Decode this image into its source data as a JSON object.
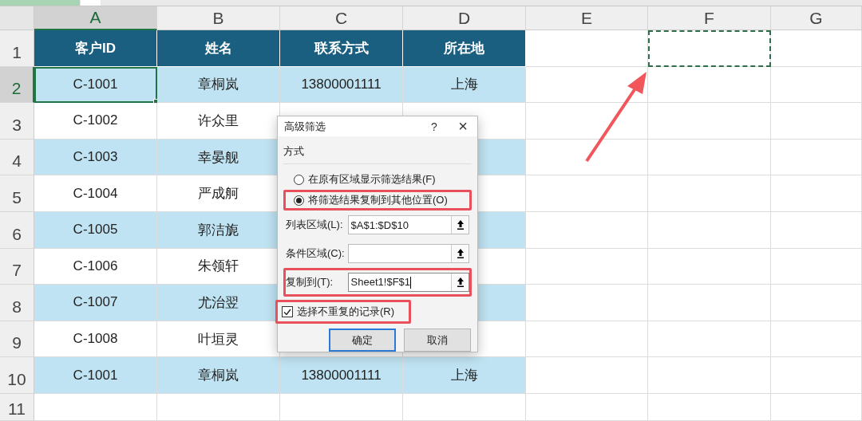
{
  "column_headers": [
    {
      "label": "A",
      "selected": true,
      "copy_outline": false
    },
    {
      "label": "B",
      "selected": false,
      "copy_outline": false
    },
    {
      "label": "C",
      "selected": false,
      "copy_outline": false
    },
    {
      "label": "D",
      "selected": false,
      "copy_outline": false
    },
    {
      "label": "E",
      "selected": false,
      "copy_outline": false
    },
    {
      "label": "F",
      "selected": false,
      "copy_outline": true
    },
    {
      "label": "G",
      "selected": false,
      "copy_outline": false
    }
  ],
  "rows": [
    {
      "label": "1",
      "selected": false,
      "kind": "header",
      "shaded": true,
      "copy_outline": true,
      "cells": [
        {
          "text": "客户ID",
          "selected": false
        },
        {
          "text": "姓名",
          "selected": false
        },
        {
          "text": "联系方式",
          "selected": false
        },
        {
          "text": "所在地",
          "selected": false
        }
      ]
    },
    {
      "label": "2",
      "selected": true,
      "kind": "data",
      "shaded": true,
      "cells": [
        {
          "text": "C-1001",
          "selected": true
        },
        {
          "text": "章桐岚",
          "selected": false
        },
        {
          "text": "13800001111",
          "selected": false
        },
        {
          "text": "上海",
          "selected": false
        }
      ]
    },
    {
      "label": "3",
      "selected": false,
      "kind": "data",
      "shaded": false,
      "cells": [
        {
          "text": "C-1002",
          "selected": false
        },
        {
          "text": "许众里",
          "selected": false
        }
      ]
    },
    {
      "label": "4",
      "selected": false,
      "kind": "data",
      "shaded": true,
      "cells": [
        {
          "text": "C-1003",
          "selected": false
        },
        {
          "text": "幸晏舰",
          "selected": false
        }
      ]
    },
    {
      "label": "5",
      "selected": false,
      "kind": "data",
      "shaded": false,
      "cells": [
        {
          "text": "C-1004",
          "selected": false
        },
        {
          "text": "严成舸",
          "selected": false
        }
      ]
    },
    {
      "label": "6",
      "selected": false,
      "kind": "data",
      "shaded": true,
      "cells": [
        {
          "text": "C-1005",
          "selected": false
        },
        {
          "text": "郭洁旎",
          "selected": false
        }
      ]
    },
    {
      "label": "7",
      "selected": false,
      "kind": "data",
      "shaded": false,
      "cells": [
        {
          "text": "C-1006",
          "selected": false
        },
        {
          "text": "朱领轩",
          "selected": false
        }
      ]
    },
    {
      "label": "8",
      "selected": false,
      "kind": "data",
      "shaded": true,
      "cells": [
        {
          "text": "C-1007",
          "selected": false
        },
        {
          "text": "尤治翌",
          "selected": false
        }
      ]
    },
    {
      "label": "9",
      "selected": false,
      "kind": "data",
      "shaded": false,
      "cells": [
        {
          "text": "C-1008",
          "selected": false
        },
        {
          "text": "叶垣灵",
          "selected": false
        }
      ]
    },
    {
      "label": "10",
      "selected": false,
      "kind": "data",
      "shaded": true,
      "cells": [
        {
          "text": "C-1001",
          "selected": false
        },
        {
          "text": "章桐岚",
          "selected": false
        },
        {
          "text": "13800001111",
          "selected": false
        },
        {
          "text": "上海",
          "selected": false
        }
      ]
    },
    {
      "label": "11",
      "selected": false,
      "shaded": false,
      "cells": []
    }
  ],
  "dialog": {
    "title": "高级筛选",
    "help": "?",
    "close": "×",
    "section": "方式",
    "options": [
      {
        "label": "在原有区域显示筛选结果(F)",
        "selected": false,
        "highlighted": false
      },
      {
        "label": "将筛选结果复制到其他位置(O)",
        "selected": true,
        "highlighted": true
      }
    ],
    "fields": [
      {
        "label": "列表区域(L):",
        "value": "$A$1:$D$10",
        "focused": false,
        "highlighted": false
      },
      {
        "label": "条件区域(C):",
        "focused": false,
        "highlighted": false
      },
      {
        "label": "复制到(T):",
        "value": "Sheet1!$F$1",
        "focused": true,
        "highlighted": true
      }
    ],
    "checkbox": {
      "label": "选择不重复的记录(R)",
      "checked": true,
      "highlighted": true
    },
    "buttons": [
      {
        "label": "确定",
        "default": true
      },
      {
        "label": "取消",
        "default": false
      }
    ]
  }
}
